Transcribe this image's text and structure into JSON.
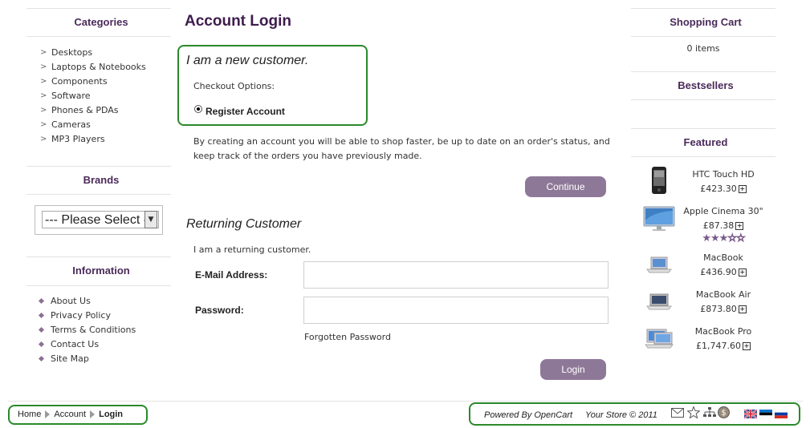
{
  "left": {
    "categories": {
      "title": "Categories",
      "items": [
        "Desktops",
        "Laptops & Notebooks",
        "Components",
        "Software",
        "Phones & PDAs",
        "Cameras",
        "MP3 Players"
      ]
    },
    "brands": {
      "title": "Brands",
      "select_value": "--- Please Select ---"
    },
    "information": {
      "title": "Information",
      "items": [
        "About Us",
        "Privacy Policy",
        "Terms & Conditions",
        "Contact Us",
        "Site Map"
      ]
    }
  },
  "main": {
    "title": "Account Login",
    "new_customer": {
      "heading": "I am a new customer.",
      "checkout_options": "Checkout Options:",
      "register_label": "Register Account",
      "description": "By creating an account you will be able to shop faster, be up to date on an order's status, and keep track of the orders you have previously made.",
      "continue_label": "Continue"
    },
    "returning": {
      "heading": "Returning Customer",
      "intro": "I am a returning customer.",
      "email_label": "E-Mail Address:",
      "email_value": "",
      "password_label": "Password:",
      "password_value": "",
      "forgotten_label": "Forgotten Password",
      "login_label": "Login"
    }
  },
  "right": {
    "cart": {
      "title": "Shopping Cart",
      "count": "0 items"
    },
    "bestsellers": {
      "title": "Bestsellers"
    },
    "featured": {
      "title": "Featured",
      "products": [
        {
          "name": "HTC Touch HD",
          "price": "£423.30",
          "icon": "phone-image"
        },
        {
          "name": "Apple Cinema 30\"",
          "price": "£87.38",
          "icon": "monitor-image",
          "rating": 3
        },
        {
          "name": "MacBook",
          "price": "£436.90",
          "icon": "laptop-image"
        },
        {
          "name": "MacBook Air",
          "price": "£873.80",
          "icon": "laptop-image"
        },
        {
          "name": "MacBook Pro",
          "price": "£1,747.60",
          "icon": "laptop-image"
        }
      ]
    }
  },
  "footer": {
    "breadcrumb": [
      "Home",
      "Account",
      "Login"
    ],
    "powered": "Powered By OpenCart",
    "copyright": "Your Store © 2011",
    "icons": [
      "mail-icon",
      "star-icon",
      "sitemap-icon",
      "currency-icon"
    ],
    "flags": [
      "flag-uk-icon",
      "flag-estonia-icon",
      "flag-russia-icon"
    ]
  },
  "colors": {
    "accent": "#8e7898",
    "title": "#3e1c4c",
    "highlight_border": "#2a8a2a"
  }
}
